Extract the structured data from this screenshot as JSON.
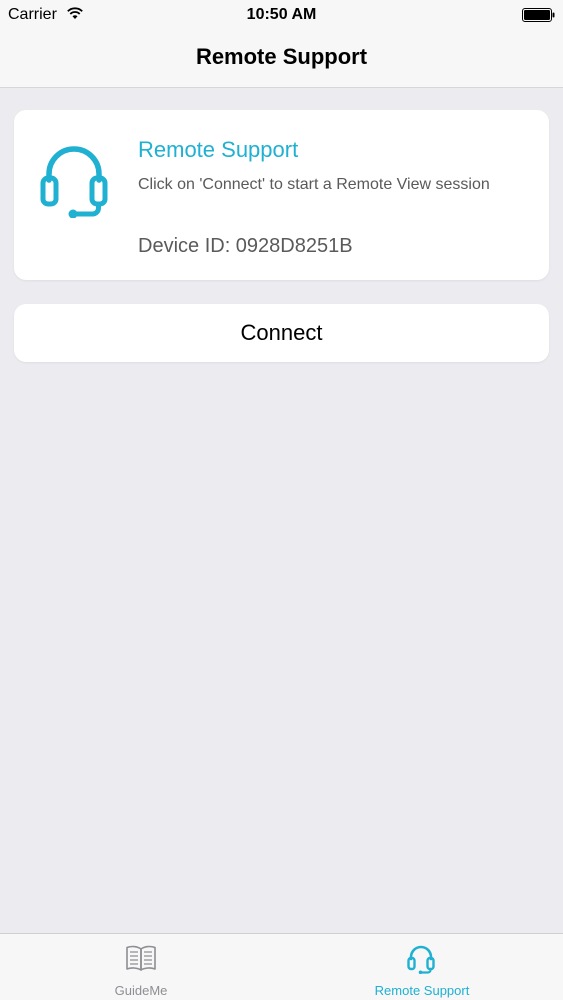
{
  "status_bar": {
    "carrier": "Carrier",
    "time": "10:50 AM",
    "wifi_icon": "wifi-icon",
    "battery_icon": "battery-icon"
  },
  "nav": {
    "title": "Remote Support"
  },
  "card": {
    "icon": "headset-icon",
    "title": "Remote Support",
    "description": "Click on 'Connect' to start a Remote View session",
    "device_id": "Device ID: 0928D8251B"
  },
  "connect_button": {
    "label": "Connect"
  },
  "tab_bar": {
    "tabs": [
      {
        "label": "GuideMe",
        "icon": "book-icon",
        "selected": false
      },
      {
        "label": "Remote Support",
        "icon": "headset-icon",
        "selected": true
      }
    ]
  },
  "colors": {
    "accent": "#1fb0d2",
    "background": "#ebebf0",
    "card": "#ffffff",
    "text_secondary": "#5a5a5a",
    "tab_inactive": "#8e8e93"
  }
}
